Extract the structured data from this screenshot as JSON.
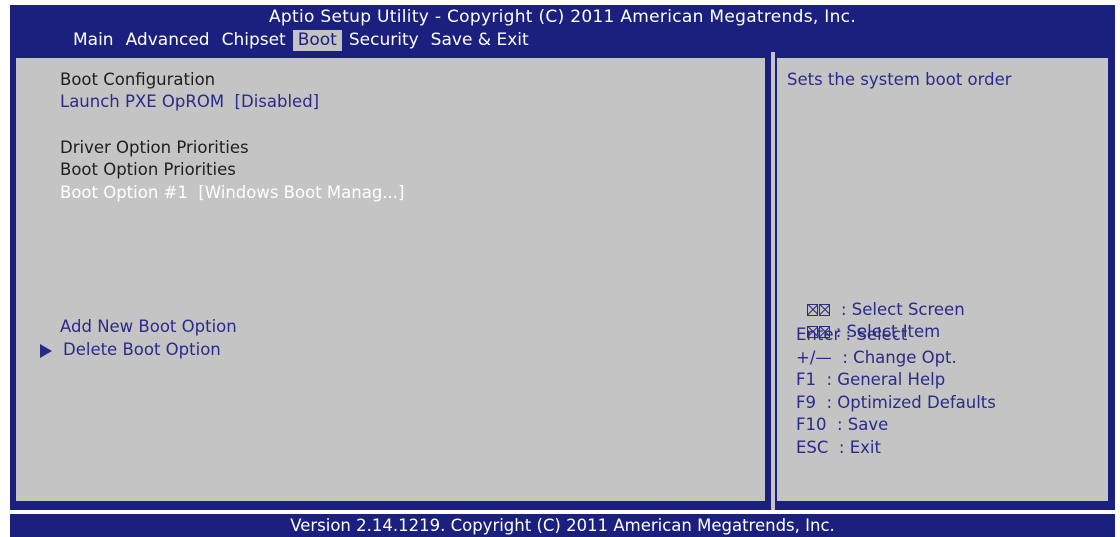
{
  "header": {
    "title": "Aptio Setup Utility - Copyright (C) 2011 American Megatrends, Inc.",
    "tabs": [
      {
        "label": "Main"
      },
      {
        "label": "Advanced"
      },
      {
        "label": "Chipset"
      },
      {
        "label": "Boot",
        "active": true
      },
      {
        "label": "Security"
      },
      {
        "label": "Save & Exit"
      }
    ]
  },
  "left_panel": {
    "boot_configuration": "Boot Configuration",
    "launch_pxe": "Launch PXE OpROM  [Disabled]",
    "driver_option_priorities": "Driver Option Priorities",
    "boot_option_priorities": "Boot Option Priorities",
    "boot_option_1": "Boot Option #1  [Windows Boot Manag...]",
    "add_new_boot_option": "Add New Boot Option",
    "delete_boot_option": "Delete Boot Option"
  },
  "right_panel": {
    "description": "Sets the system boot order",
    "help": {
      "select_screen": "  : Select Screen",
      "select_item": " : Select Item",
      "enter": "Enter : Select",
      "change_opt": "+/—  : Change Opt.",
      "f1": "F1  : General Help",
      "f9": "F9  : Optimized Defaults",
      "f10": "F10  : Save",
      "esc": "ESC  : Exit"
    }
  },
  "footer": {
    "version": "Version 2.14.1219. Copyright (C) 2011 American Megatrends, Inc."
  },
  "colors": {
    "background_blue": "#1b1f7d",
    "panel_gray": "#c4c4c4",
    "item_blue": "#2a2a8a",
    "selected_white": "#ffffff"
  }
}
